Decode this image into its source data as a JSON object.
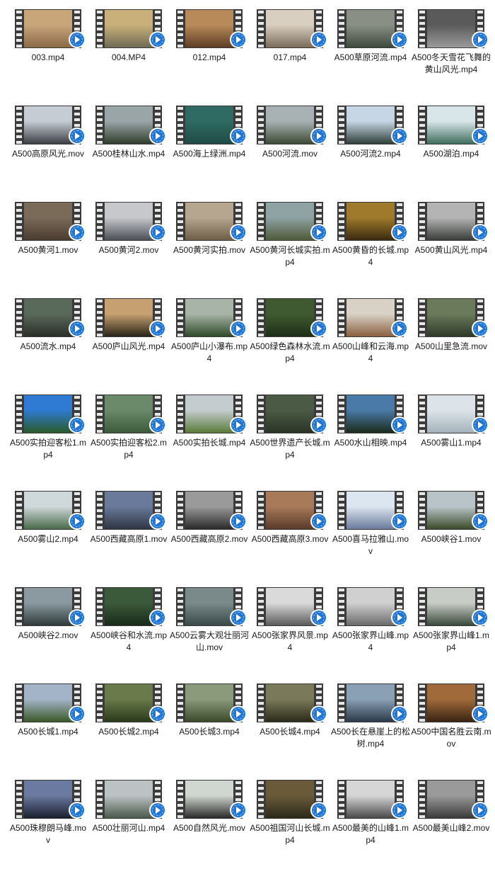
{
  "badge_icon": "video-player-badge-icon",
  "badge_color": "#1f76d2",
  "files": [
    {
      "name": "003.mp4",
      "colors": [
        "#c9a57a",
        "#8a6a48"
      ]
    },
    {
      "name": "004.MP4",
      "colors": [
        "#c9b07a",
        "#6f6a55"
      ]
    },
    {
      "name": "012.mp4",
      "colors": [
        "#b88a5a",
        "#5e3d24"
      ]
    },
    {
      "name": "017.mp4",
      "colors": [
        "#d8cfc0",
        "#7a6b5a"
      ]
    },
    {
      "name": "A500草原河流.mp4",
      "colors": [
        "#8a8f86",
        "#3e4a3c"
      ]
    },
    {
      "name": "A500冬天雪花飞舞的黄山风光.mp4",
      "colors": [
        "#5a5a5a",
        "#9a9a9a"
      ]
    },
    {
      "name": "A500高原风光.mov",
      "colors": [
        "#c5ccd4",
        "#3c3f44"
      ]
    },
    {
      "name": "A500桂林山水.mp4",
      "colors": [
        "#9aa5a8",
        "#2f3d2c"
      ]
    },
    {
      "name": "A500海上绿洲.mp4",
      "colors": [
        "#2f6b62",
        "#1f4a45"
      ]
    },
    {
      "name": "A500河流.mov",
      "colors": [
        "#a8b2b4",
        "#3d4a35"
      ]
    },
    {
      "name": "A500河流2.mp4",
      "colors": [
        "#c6d6e4",
        "#2f3f3a"
      ]
    },
    {
      "name": "A500湖泊.mp4",
      "colors": [
        "#d8e6ea",
        "#3f6e5c"
      ]
    },
    {
      "name": "A500黄河1.mov",
      "colors": [
        "#7a6a58",
        "#4a3c30"
      ]
    },
    {
      "name": "A500黄河2.mov",
      "colors": [
        "#c6c8cc",
        "#4c4f56"
      ]
    },
    {
      "name": "A500黄河实拍.mov",
      "colors": [
        "#b6a690",
        "#6e5e48"
      ]
    },
    {
      "name": "A500黄河长城实拍.mp4",
      "colors": [
        "#8fa2a4",
        "#4e5a3a"
      ]
    },
    {
      "name": "A500黄昏的长城.mp4",
      "colors": [
        "#a07a2c",
        "#3a2a10"
      ]
    },
    {
      "name": "A500黄山风光.mp4",
      "colors": [
        "#b4b4b4",
        "#3a3d3a"
      ]
    },
    {
      "name": "A500流水.mp4",
      "colors": [
        "#5a6a5a",
        "#2a2f2a"
      ]
    },
    {
      "name": "A500庐山风光.mp4",
      "colors": [
        "#c6a070",
        "#2a2418"
      ]
    },
    {
      "name": "A500庐山小瀑布.mp4",
      "colors": [
        "#a8b4a8",
        "#2f4a2a"
      ]
    },
    {
      "name": "A500绿色森林水流.mp4",
      "colors": [
        "#3f5a30",
        "#1f2f18"
      ]
    },
    {
      "name": "A500山峰和云海.mp4",
      "colors": [
        "#d8d2c6",
        "#8a6040"
      ]
    },
    {
      "name": "A500山里急流.mov",
      "colors": [
        "#6a7a5a",
        "#2f3a2a"
      ]
    },
    {
      "name": "A500实拍迎客松1.mp4",
      "colors": [
        "#2f7ad2",
        "#2a5a2a"
      ]
    },
    {
      "name": "A500实拍迎客松2.mp4",
      "colors": [
        "#6a8a6a",
        "#3a5a3a"
      ]
    },
    {
      "name": "A500实拍长城.mp4",
      "colors": [
        "#c4ccd0",
        "#5a7a3a"
      ]
    },
    {
      "name": "A500世界遗产长城.mp4",
      "colors": [
        "#4a5a44",
        "#2a3426"
      ]
    },
    {
      "name": "A500水山相映.mp4",
      "colors": [
        "#4a7aa8",
        "#1a2a1a"
      ]
    },
    {
      "name": "A500雾山1.mp4",
      "colors": [
        "#dce4ea",
        "#a4b2ba"
      ]
    },
    {
      "name": "A500雾山2.mp4",
      "colors": [
        "#cfd8da",
        "#4a6a4a"
      ]
    },
    {
      "name": "A500西藏高原1.mov",
      "colors": [
        "#6a7a9a",
        "#2f3544"
      ]
    },
    {
      "name": "A500西藏高原2.mov",
      "colors": [
        "#9a9a9a",
        "#2a2a2a"
      ]
    },
    {
      "name": "A500西藏高原3.mov",
      "colors": [
        "#a87a5a",
        "#5a3a2a"
      ]
    },
    {
      "name": "A500喜马拉雅山.mov",
      "colors": [
        "#dce6f0",
        "#6a7a9a"
      ]
    },
    {
      "name": "A500峡谷1.mov",
      "colors": [
        "#b8c4c8",
        "#3a4a2a"
      ]
    },
    {
      "name": "A500峡谷2.mov",
      "colors": [
        "#8a9aa0",
        "#2f3a3a"
      ]
    },
    {
      "name": "A500峡谷和水流.mp4",
      "colors": [
        "#3a5a3a",
        "#1a2a1a"
      ]
    },
    {
      "name": "A500云雾大观壮丽河山.mov",
      "colors": [
        "#7a8a8a",
        "#3a4a4a"
      ]
    },
    {
      "name": "A500张家界风景.mp4",
      "colors": [
        "#dadada",
        "#5a5a5a"
      ]
    },
    {
      "name": "A500张家界山峰.mp4",
      "colors": [
        "#d0d0d0",
        "#6a6a6a"
      ]
    },
    {
      "name": "A500张家界山峰1.mp4",
      "colors": [
        "#c8ccc6",
        "#3a4a3a"
      ]
    },
    {
      "name": "A500长城1.mp4",
      "colors": [
        "#a4b4c8",
        "#3a5a2a"
      ]
    },
    {
      "name": "A500长城2.mp4",
      "colors": [
        "#6a7a4a",
        "#2a3a1a"
      ]
    },
    {
      "name": "A500长城3.mp4",
      "colors": [
        "#8a9a7a",
        "#3a4a2a"
      ]
    },
    {
      "name": "A500长城4.mp4",
      "colors": [
        "#7a7a5a",
        "#2a2a1a"
      ]
    },
    {
      "name": "A500长在悬崖上的松树.mp4",
      "colors": [
        "#8aa0b4",
        "#2a3a4a"
      ]
    },
    {
      "name": "A500中国名胜云南.mov",
      "colors": [
        "#a06a3a",
        "#3a2414"
      ]
    },
    {
      "name": "A500珠穆朗马峰.mov",
      "colors": [
        "#6a7aa0",
        "#1a1f2f"
      ]
    },
    {
      "name": "A500壮丽河山.mp4",
      "colors": [
        "#bcc2c4",
        "#4a5a4a"
      ]
    },
    {
      "name": "A500自然风光.mov",
      "colors": [
        "#d0d6d0",
        "#2a2a2a"
      ]
    },
    {
      "name": "A500祖国河山长城.mp4",
      "colors": [
        "#6a5a3a",
        "#2a2a1a"
      ]
    },
    {
      "name": "A500最美的山峰1.mp4",
      "colors": [
        "#d6d6d6",
        "#4a4a4a"
      ]
    },
    {
      "name": "A500最美山峰2.mov",
      "colors": [
        "#9a9a9a",
        "#3a3a3a"
      ]
    }
  ]
}
